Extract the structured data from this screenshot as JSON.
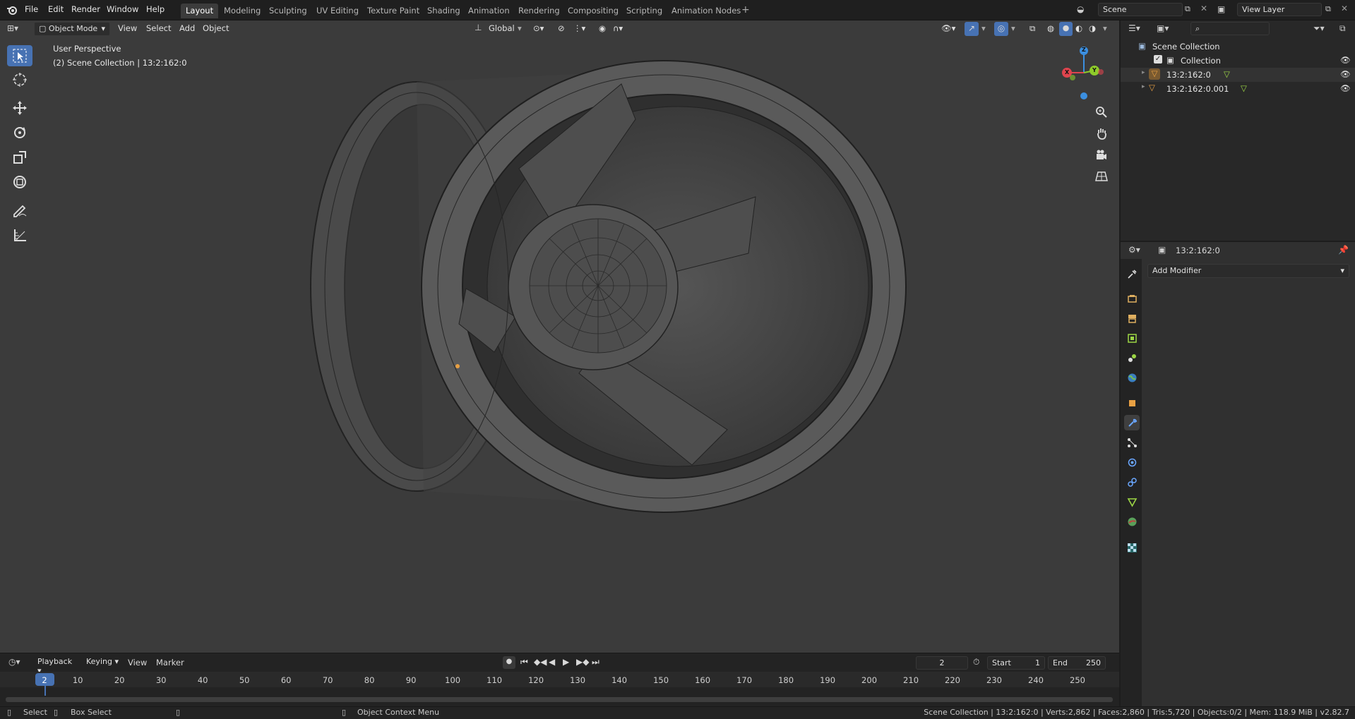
{
  "topbar": {
    "menus": [
      "File",
      "Edit",
      "Render",
      "Window",
      "Help"
    ],
    "workspaces": [
      "Layout",
      "Modeling",
      "Sculpting",
      "UV Editing",
      "Texture Paint",
      "Shading",
      "Animation",
      "Rendering",
      "Compositing",
      "Scripting",
      "Animation Nodes"
    ],
    "active_workspace": "Layout",
    "scene": "Scene",
    "view_layer": "View Layer"
  },
  "viewport_header": {
    "mode": "Object Mode",
    "menus": [
      "View",
      "Select",
      "Add",
      "Object"
    ],
    "orientation": "Global"
  },
  "viewport": {
    "perspective_label": "User Perspective",
    "collection_label": "(2) Scene Collection | 13:2:162:0",
    "gizmo_axes": {
      "x": "X",
      "y": "Y",
      "z": "Z"
    }
  },
  "timeline": {
    "menus": [
      "Playback",
      "Keying",
      "View",
      "Marker"
    ],
    "current_frame": "2",
    "start_label": "Start",
    "start_value": "1",
    "end_label": "End",
    "end_value": "250",
    "ticks": [
      "2",
      "10",
      "20",
      "30",
      "40",
      "50",
      "60",
      "70",
      "80",
      "90",
      "100",
      "110",
      "120",
      "130",
      "140",
      "150",
      "160",
      "170",
      "180",
      "190",
      "200",
      "210",
      "220",
      "230",
      "240",
      "250"
    ]
  },
  "outliner": {
    "search_placeholder": "",
    "scene_collection": "Scene Collection",
    "collection": "Collection",
    "objects": [
      "13:2:162:0",
      "13:2:162:0.001"
    ]
  },
  "properties": {
    "object_name": "13:2:162:0",
    "add_modifier": "Add Modifier"
  },
  "statusbar": {
    "select": "Select",
    "box_select": "Box Select",
    "context_menu": "Object Context Menu",
    "stats": "Scene Collection | 13:2:162:0 | Verts:2,862 | Faces:2,860 | Tris:5,720 | Objects:0/2 | Mem: 118.9 MiB | v2.82.7"
  },
  "colors": {
    "accent": "#4772b3",
    "axis_x": "#e0444e",
    "axis_y": "#8ecb2a",
    "axis_z": "#3b8fe0",
    "mesh_icon": "#e8a043",
    "data_icon": "#9cd645"
  }
}
